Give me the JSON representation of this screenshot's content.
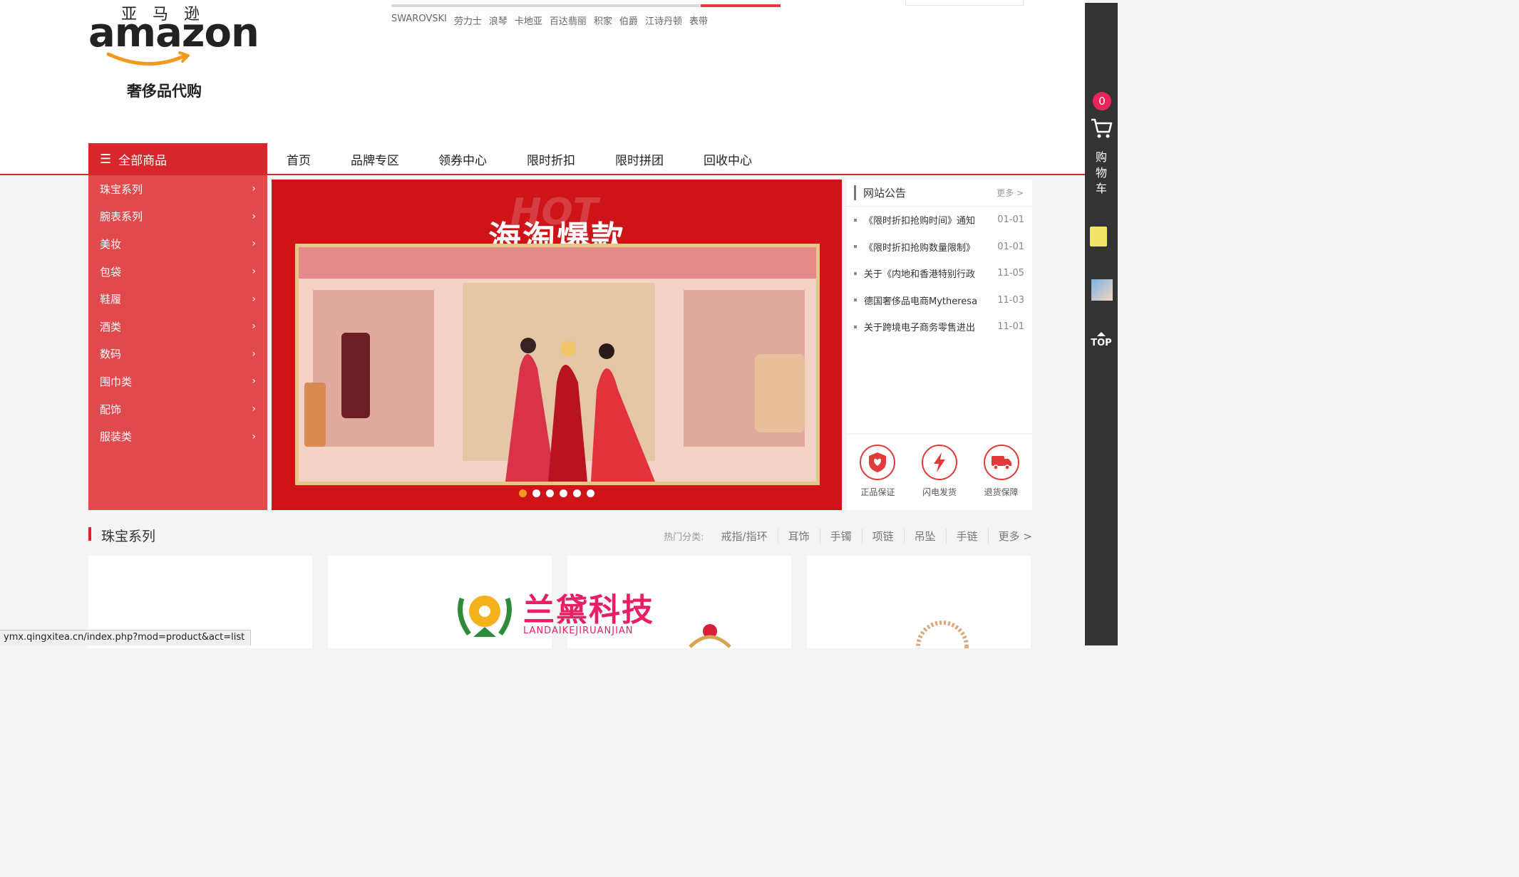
{
  "brand": {
    "cn": "亚马逊",
    "word": "amazon",
    "sub": "奢侈品代购"
  },
  "hot_searches": [
    "SWAROVSKI",
    "劳力士",
    "浪琴",
    "卡地亚",
    "百达翡丽",
    "积家",
    "伯爵",
    "江诗丹顿",
    "表带"
  ],
  "nav": {
    "all_label": "全部商品",
    "items": [
      "首页",
      "品牌专区",
      "领券中心",
      "限时折扣",
      "限时拼团",
      "回收中心"
    ]
  },
  "categories": [
    "珠宝系列",
    "腕表系列",
    "美妆",
    "包袋",
    "鞋履",
    "酒类",
    "数码",
    "围巾类",
    "配饰",
    "服装类"
  ],
  "banner": {
    "hot_text": "HOT",
    "title": "海淘爆款",
    "slides": 6,
    "active_slide": 0
  },
  "notice": {
    "title": "网站公告",
    "more": "更多 >",
    "items": [
      {
        "text": "《限时折扣抢购时间》通知",
        "date": "01-01"
      },
      {
        "text": "《限时折扣抢购数量限制》",
        "date": "01-01"
      },
      {
        "text": "关于《内地和香港特别行政",
        "date": "11-05"
      },
      {
        "text": "德国奢侈品电商Mytheresa",
        "date": "11-03"
      },
      {
        "text": "关于跨境电子商务零售进出",
        "date": "11-01"
      }
    ]
  },
  "services": [
    {
      "label": "正品保证",
      "icon": "shield-heart-icon"
    },
    {
      "label": "闪电发货",
      "icon": "lightning-icon"
    },
    {
      "label": "退货保障",
      "icon": "truck-icon"
    }
  ],
  "section": {
    "title": "珠宝系列",
    "hot_label": "热门分类:",
    "hot_cats": [
      "戒指/指环",
      "耳饰",
      "手镯",
      "项链",
      "吊坠",
      "手链"
    ],
    "more": "更多 >"
  },
  "sidebar": {
    "cart_count": "0",
    "cart_label": "购物车",
    "top_label": "TOP"
  },
  "watermark": {
    "text": "兰黛科技",
    "sub": "LANDAIKEJIRUANJIAN"
  },
  "status_url": "ymx.qingxitea.cn/index.php?mod=product&act=list",
  "colors": {
    "brand_red": "#d7262c",
    "menu_red": "#e04a4d",
    "banner_red": "#cf1419",
    "badge_pink": "#e8245a"
  }
}
